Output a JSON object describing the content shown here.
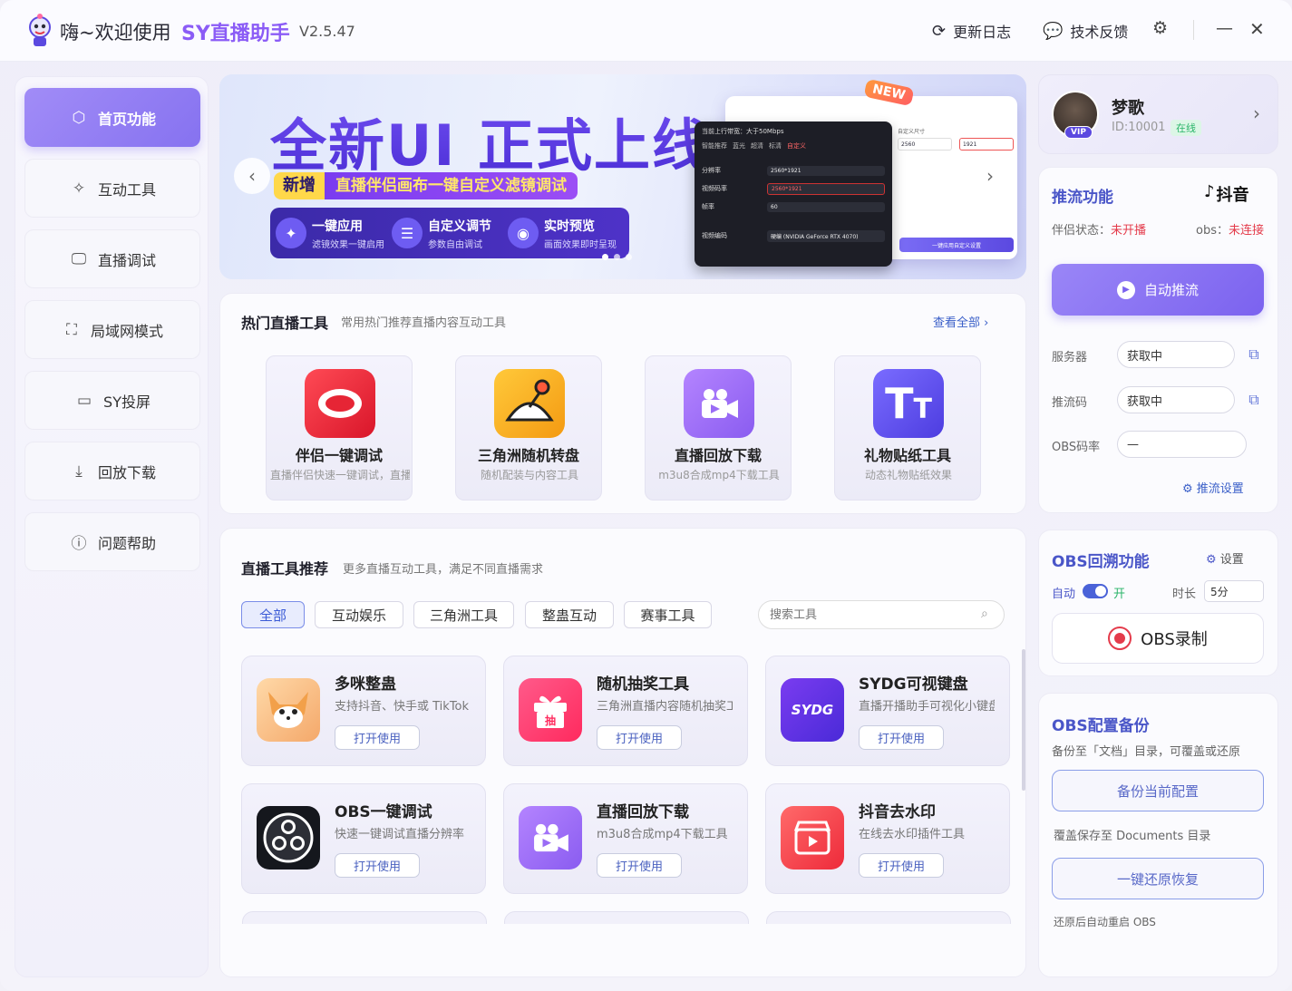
{
  "titlebar": {
    "greeting": "嗨~欢迎使用",
    "brand": "SY直播助手",
    "version": "V2.5.47",
    "changelog": "更新日志",
    "feedback": "技术反馈"
  },
  "sidebar": {
    "items": [
      {
        "label": "首页功能",
        "icon": "cube-icon"
      },
      {
        "label": "互动工具",
        "icon": "sparkle-icon"
      },
      {
        "label": "直播调试",
        "icon": "monitor-icon"
      },
      {
        "label": "局域网模式",
        "icon": "lan-icon"
      },
      {
        "label": "SY投屏",
        "icon": "cast-icon"
      },
      {
        "label": "回放下载",
        "icon": "download-icon"
      },
      {
        "label": "问题帮助",
        "icon": "help-icon"
      }
    ]
  },
  "banner": {
    "title": "全新UI 正式上线",
    "tag_new": "新增",
    "tag_text": "直播伴侣画布一键自定义滤镜调试",
    "badge": "NEW",
    "features": [
      {
        "title": "一键应用",
        "sub": "滤镜效果一键启用"
      },
      {
        "title": "自定义调节",
        "sub": "参数自由调试"
      },
      {
        "title": "实时预览",
        "sub": "画面效果即时呈现"
      }
    ],
    "mock": {
      "bandwidth": "当前上行带宽：大于50Mbps",
      "res_label": "分辨率",
      "res_value": "2560*1921",
      "bitrate_label": "视频码率",
      "bitrate_value": "2560*1921",
      "fps_label": "帧率",
      "fps_value": "60",
      "enc_label": "视频编码",
      "enc_value": "硬编 (NVIDIA GeForce RTX 4070)",
      "opts": [
        "智能推荐",
        "蓝光",
        "超清",
        "标清",
        "自定义"
      ],
      "custom": "自定义尺寸",
      "w": "2560",
      "h": "1921",
      "apply": "一键应用自定义设置"
    }
  },
  "hot": {
    "title": "热门直播工具",
    "subtitle": "常用热门推荐直播内容互动工具",
    "view_all": "查看全部",
    "cards": [
      {
        "name": "伴侣一键调试",
        "desc": "直播伴侣快速一键调试，直播",
        "color": "#ee2a3a"
      },
      {
        "name": "三角洲随机转盘",
        "desc": "随机配装与内容工具",
        "color": "#f6a21a"
      },
      {
        "name": "直播回放下载",
        "desc": "m3u8合成mp4下载工具",
        "color": "#9a6cf5"
      },
      {
        "name": "礼物贴纸工具",
        "desc": "动态礼物贴纸效果",
        "color": "#6a5cf0"
      }
    ]
  },
  "recommend": {
    "title": "直播工具推荐",
    "subtitle": "更多直播互动工具，满足不同直播需求",
    "chips": [
      "全部",
      "互动娱乐",
      "三角洲工具",
      "整蛊互动",
      "赛事工具"
    ],
    "search_placeholder": "搜索工具",
    "open_label": "打开使用",
    "cards": [
      {
        "name": "多咪整蛊",
        "desc": "支持抖音、快手或 TikTok",
        "icon": "fox-icon"
      },
      {
        "name": "随机抽奖工具",
        "desc": "三角洲直播内容随机抽奖工",
        "icon": "gift-icon"
      },
      {
        "name": "SYDG可视键盘",
        "desc": "直播开播助手可视化小键盘",
        "icon": "sydg-icon"
      },
      {
        "name": "OBS一键调试",
        "desc": "快速一键调试直播分辨率",
        "icon": "obs-icon"
      },
      {
        "name": "直播回放下载",
        "desc": "m3u8合成mp4下载工具",
        "icon": "video-icon"
      },
      {
        "name": "抖音去水印",
        "desc": "在线去水印插件工具",
        "icon": "clapper-icon"
      }
    ]
  },
  "user": {
    "name": "梦歌",
    "id": "ID:10001",
    "status": "在线",
    "vip": "VIP"
  },
  "push": {
    "title": "推流功能",
    "platform": "抖音",
    "companion_label": "伴侣状态：",
    "companion_value": "未开播",
    "obs_label": "obs：",
    "obs_value": "未连接",
    "start": "自动推流",
    "server_label": "服务器",
    "server_value": "获取中",
    "key_label": "推流码",
    "key_value": "获取中",
    "bitrate_label": "OBS码率",
    "bitrate_value": "—",
    "settings": "推流设置"
  },
  "replay": {
    "title": "OBS回溯功能",
    "settings": "设置",
    "auto_label": "自动",
    "auto_state": "开",
    "duration_label": "时长",
    "duration_value": "5分",
    "record": "OBS录制"
  },
  "backup": {
    "title": "OBS配置备份",
    "desc": "备份至「文档」目录，可覆盖或还原",
    "backup_btn": "备份当前配置",
    "backup_note": "覆盖保存至 Documents 目录",
    "restore_btn": "一键还原恢复",
    "restore_note": "还原后自动重启 OBS"
  },
  "colors": {
    "accent": "#8672f0",
    "link": "#4a56c8",
    "danger": "#e43b4b",
    "online": "#2bb56a"
  }
}
